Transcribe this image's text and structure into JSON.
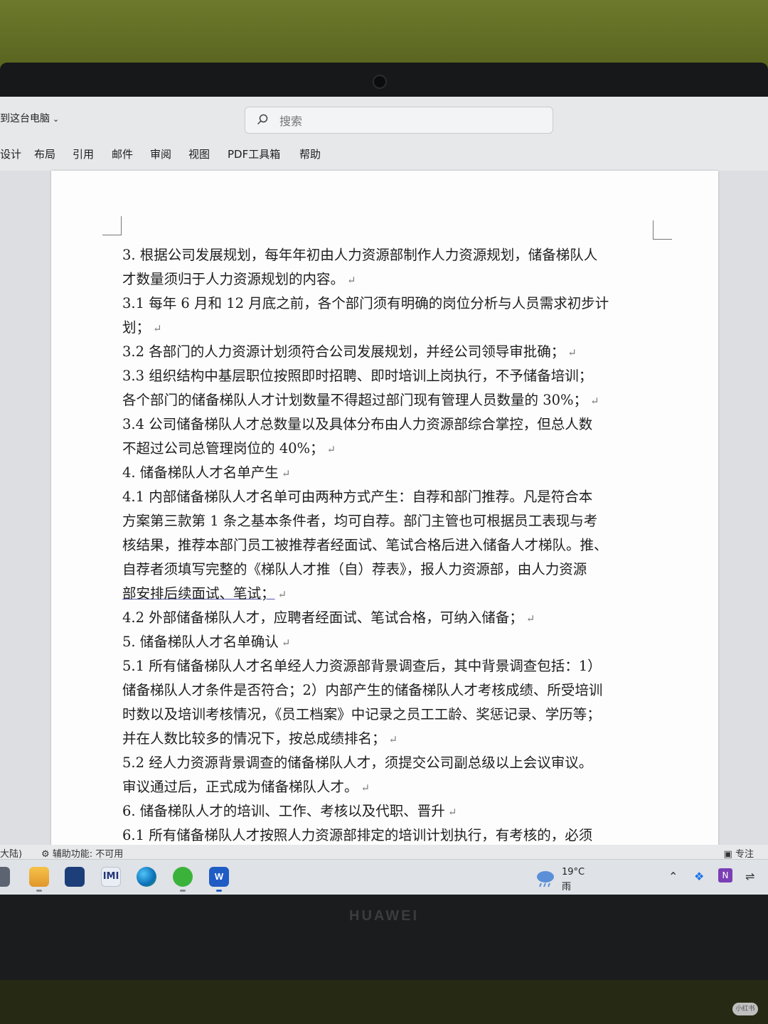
{
  "titlebar": {
    "location": "到这台电脑",
    "search_placeholder": "搜索"
  },
  "ribbon": {
    "tabs": [
      "设计",
      "布局",
      "引用",
      "邮件",
      "审阅",
      "视图",
      "PDF工具箱",
      "帮助"
    ]
  },
  "document": {
    "lines": [
      "3. 根据公司发展规划，每年年初由人力资源部制作人力资源规划，储备梯队人",
      "才数量须归于人力资源规划的内容。",
      "3.1 每年 6 月和 12 月底之前，各个部门须有明确的岗位分析与人员需求初步计",
      "划；",
      "3.2  各部门的人力资源计划须符合公司发展规划，并经公司领导审批确；",
      "3.3 组织结构中基层职位按照即时招聘、即时培训上岗执行，不予储备培训；",
      "各个部门的储备梯队人才计划数量不得超过部门现有管理人员数量的 30%；",
      "3.4 公司储备梯队人才总数量以及具体分布由人力资源部综合掌控，但总人数",
      "不超过公司总管理岗位的 40%；",
      "4.  储备梯队人才名单产生",
      "4.1 内部储备梯队人才名单可由两种方式产生：自荐和部门推荐。凡是符合本",
      "方案第三款第 1 条之基本条件者，均可自荐。部门主管也可根据员工表现与考",
      "核结果，推荐本部门员工被推荐者经面试、笔试合格后进入储备人才梯队。推、",
      "自荐者须填写完整的《梯队人才推（自）荐表》，报人力资源部，由人力资源",
      "部安排后续面试、笔试；",
      "4.2 外部储备梯队人才，应聘者经面试、笔试合格，可纳入储备；",
      "5.  储备梯队人才名单确认",
      "5.1 所有储备梯队人才名单经人力资源部背景调查后，其中背景调查包括：1）",
      "储备梯队人才条件是否符合；2）内部产生的储备梯队人才考核成绩、所受培训",
      "时数以及培训考核情况，《员工档案》中记录之员工工龄、奖惩记录、学历等；",
      "并在人数比较多的情况下，按总成绩排名；",
      "5.2  经人力资源背景调查的储备梯队人才，须提交公司副总级以上会议审议。",
      "审议通过后，正式成为储备梯队人才。",
      "6.  储备梯队人才的培训、工作、考核以及代职、晋升",
      "6.1 所有储备梯队人才按照人力资源部排定的培训计划执行，有考核的，必须"
    ],
    "paragraph_mark": "↵"
  },
  "statusbar": {
    "language": "大陆)",
    "accessibility": "辅助功能: 不可用",
    "focus": "专注"
  },
  "taskbar": {
    "weather_temp": "19°C",
    "weather_cond": "雨"
  },
  "device": {
    "brand": "HUAWEI"
  },
  "watermark": "小红书"
}
